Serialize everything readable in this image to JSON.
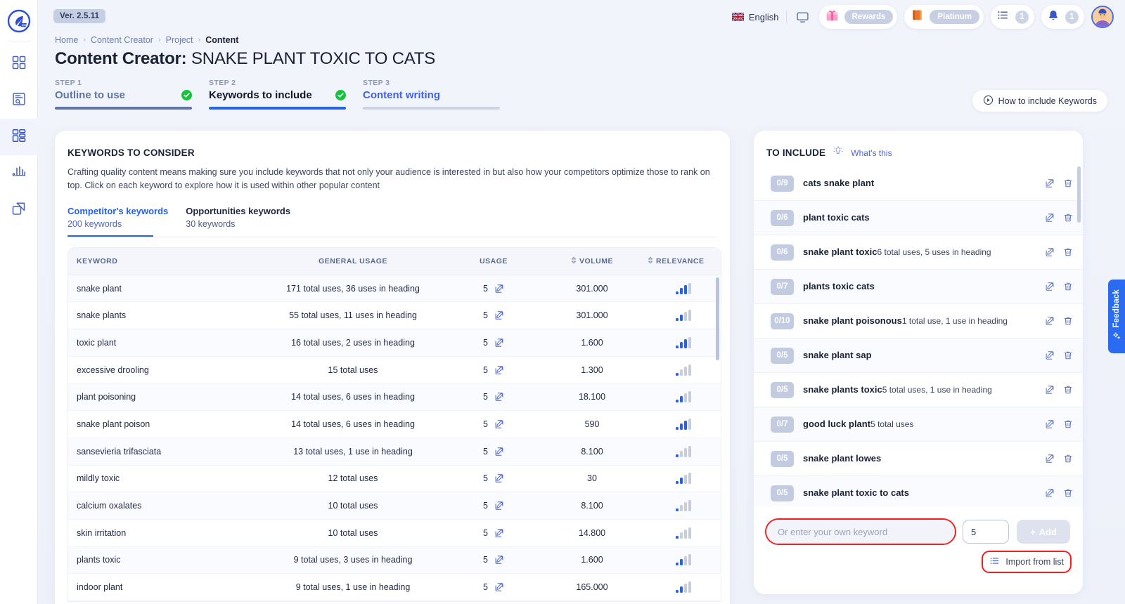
{
  "app": {
    "version_badge": "Ver. 2.5.11",
    "logo_icon": "feather-pen-logo-icon"
  },
  "sidebar": {
    "items": [
      {
        "name": "dashboard",
        "icon": "grid-dashboard-icon"
      },
      {
        "name": "research",
        "icon": "document-search-icon"
      },
      {
        "name": "content-creator",
        "icon": "layout-list-icon",
        "active": true
      },
      {
        "name": "analytics",
        "icon": "bar-chart-icon"
      },
      {
        "name": "assets",
        "icon": "layers-copy-icon"
      }
    ]
  },
  "header": {
    "language": "English",
    "language_flag": "uk-flag-icon",
    "monitor_icon": "monitor-icon",
    "rewards": {
      "icon": "gift-icon",
      "label": "Rewards"
    },
    "plan": {
      "icon": "book-icon",
      "label": "Platinum"
    },
    "tasks": {
      "icon": "list-icon",
      "count": "1"
    },
    "notifications": {
      "icon": "bell-icon",
      "count": "1"
    },
    "avatar": "user-avatar"
  },
  "breadcrumb": {
    "items": [
      "Home",
      "Content Creator",
      "Project"
    ],
    "current": "Content"
  },
  "page": {
    "title_prefix": "Content Creator:",
    "title_value": "SNAKE PLANT TOXIC TO CATS"
  },
  "steps": [
    {
      "label": "STEP 1",
      "title": "Outline to use",
      "state": "done"
    },
    {
      "label": "STEP 2",
      "title": "Keywords to include",
      "state": "current"
    },
    {
      "label": "STEP 3",
      "title": "Content writing",
      "state": "todo"
    }
  ],
  "howto": {
    "label": "How to include Keywords",
    "icon": "play-circle-icon"
  },
  "keywords_panel": {
    "title": "KEYWORDS TO CONSIDER",
    "description": "Crafting quality content means making sure you include keywords that not only your audience is interested in but also how your competitors optimize those to rank on top. Click on each keyword to explore how it is used within other popular content",
    "tabs": [
      {
        "label": "Competitor's keywords",
        "sub": "200 keywords",
        "active": true
      },
      {
        "label": "Opportunities keywords",
        "sub": "30 keywords",
        "active": false
      }
    ],
    "columns": [
      "KEYWORD",
      "GENERAL USAGE",
      "USAGE",
      "VOLUME",
      "RELEVANCE"
    ],
    "sortable": [
      "VOLUME",
      "RELEVANCE"
    ],
    "rows": [
      {
        "keyword": "snake plant",
        "usage_text": "171 total uses, 36 uses in heading",
        "usage": "5",
        "volume": "301.000",
        "relevance": 3
      },
      {
        "keyword": "snake plants",
        "usage_text": "55 total uses, 11 uses in heading",
        "usage": "5",
        "volume": "301.000",
        "relevance": 2
      },
      {
        "keyword": "toxic plant",
        "usage_text": "16 total uses, 2 uses in heading",
        "usage": "5",
        "volume": "1.600",
        "relevance": 3
      },
      {
        "keyword": "excessive drooling",
        "usage_text": "15 total uses",
        "usage": "5",
        "volume": "1.300",
        "relevance": 1
      },
      {
        "keyword": "plant poisoning",
        "usage_text": "14 total uses, 6 uses in heading",
        "usage": "5",
        "volume": "18.100",
        "relevance": 2
      },
      {
        "keyword": "snake plant poison",
        "usage_text": "14 total uses, 6 uses in heading",
        "usage": "5",
        "volume": "590",
        "relevance": 3
      },
      {
        "keyword": "sansevieria trifasciata",
        "usage_text": "13 total uses, 1 use in heading",
        "usage": "5",
        "volume": "8.100",
        "relevance": 1
      },
      {
        "keyword": "mildly toxic",
        "usage_text": "12 total uses",
        "usage": "5",
        "volume": "30",
        "relevance": 2
      },
      {
        "keyword": "calcium oxalates",
        "usage_text": "10 total uses",
        "usage": "5",
        "volume": "8.100",
        "relevance": 1
      },
      {
        "keyword": "skin irritation",
        "usage_text": "10 total uses",
        "usage": "5",
        "volume": "14.800",
        "relevance": 1
      },
      {
        "keyword": "plants toxic",
        "usage_text": "9 total uses, 3 uses in heading",
        "usage": "5",
        "volume": "1.600",
        "relevance": 2
      },
      {
        "keyword": "indoor plant",
        "usage_text": "9 total uses, 1 use in heading",
        "usage": "5",
        "volume": "165.000",
        "relevance": 2
      }
    ]
  },
  "to_include": {
    "title": "TO INCLUDE",
    "whats_this": "What's this",
    "whats_this_icon": "lightbulb-icon",
    "edit_icon": "edit-pencil-icon",
    "delete_icon": "trash-icon",
    "items": [
      {
        "count": "0/9",
        "keyword": "cats snake plant",
        "sub": ""
      },
      {
        "count": "0/6",
        "keyword": "plant toxic cats",
        "sub": ""
      },
      {
        "count": "0/6",
        "keyword": "snake plant toxic",
        "sub": "6 total uses, 5 uses in heading"
      },
      {
        "count": "0/7",
        "keyword": "plants toxic cats",
        "sub": ""
      },
      {
        "count": "0/10",
        "keyword": "snake plant poisonous",
        "sub": "1 total use, 1 use in heading"
      },
      {
        "count": "0/5",
        "keyword": "snake plant sap",
        "sub": ""
      },
      {
        "count": "0/5",
        "keyword": "snake plants toxic",
        "sub": "5 total uses, 1 use in heading"
      },
      {
        "count": "0/7",
        "keyword": "good luck plant",
        "sub": "5 total uses"
      },
      {
        "count": "0/5",
        "keyword": "snake plant lowes",
        "sub": ""
      },
      {
        "count": "0/5",
        "keyword": "snake plant toxic to cats",
        "sub": ""
      }
    ],
    "footer": {
      "keyword_placeholder": "Or enter your own keyword",
      "keyword_value": "",
      "count_value": "5",
      "add_label": "Add",
      "import_label": "Import from list",
      "import_icon": "list-icon"
    }
  },
  "feedback": {
    "label": "Feedback",
    "icon": "star-sparkle-icon"
  },
  "colors": {
    "accent": "#2563eb",
    "page_bg": "#eef1f9",
    "success": "#17c23d",
    "highlight": "#f81d1d",
    "badge_grey": "#c3cbe0"
  }
}
